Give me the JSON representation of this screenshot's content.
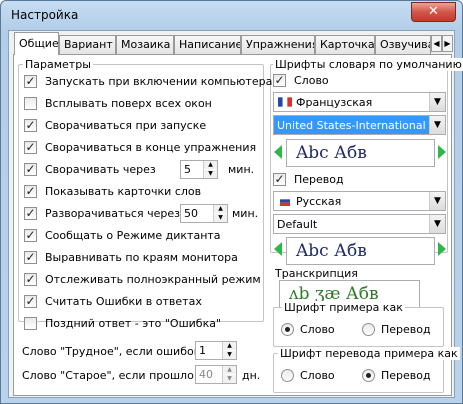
{
  "window": {
    "title": "Настройка",
    "close_glyph": "✕"
  },
  "tabs": [
    "Общие",
    "Вариант",
    "Мозаика",
    "Написание",
    "Упражнения",
    "Карточка",
    "Озвучива"
  ],
  "tab_scroll": {
    "left": "◀",
    "right": "▶"
  },
  "params": {
    "legend": "Параметры",
    "items": [
      {
        "label": "Запускать при включении компьютера",
        "checked": true
      },
      {
        "label": "Всплывать поверх всех окон",
        "checked": false
      },
      {
        "label": "Сворачиваться при запуске",
        "checked": true
      },
      {
        "label": "Сворачиваться в конце упражнения",
        "checked": true
      },
      {
        "label": "Сворачивать через",
        "checked": true
      },
      {
        "label": "Показывать карточки слов",
        "checked": true
      },
      {
        "label": "Разворачиваться через",
        "checked": true
      },
      {
        "label": "Сообщать о Режиме диктанта",
        "checked": true
      },
      {
        "label": "Выравнивать по краям монитора",
        "checked": true
      },
      {
        "label": "Отслеживать полноэкранный режим",
        "checked": true
      },
      {
        "label": "Считать Ошибки в ответах",
        "checked": true
      },
      {
        "label": "Поздний ответ - это \"Ошибка\"",
        "checked": false
      }
    ],
    "collapse_value": "5",
    "collapse_unit": "мин.",
    "expand_value": "50",
    "expand_unit": "мин.",
    "hard_label": "Слово \"Трудное\", если ошибок >",
    "hard_value": "1",
    "old_label": "Слово \"Старое\", если прошло >",
    "old_value": "40",
    "old_unit": "дн."
  },
  "fonts": {
    "legend": "Шрифты словаря по умолчанию",
    "word_label": "Слово",
    "word_checked": true,
    "word_language": "Французская",
    "word_layout": "United States-International ...",
    "word_sample": "Abc Абв",
    "translation_label": "Перевод",
    "translation_checked": true,
    "translation_language": "Русская",
    "translation_layout": "Default",
    "translation_sample": "Abc Абв",
    "transcription_legend": "Транскрипция",
    "transcription_sample": "ʌb ʒæ Абв",
    "example_font_legend": "Шрифт примера как",
    "example_font_options": [
      "Слово",
      "Перевод"
    ],
    "example_font_selected": 0,
    "example_translation_legend": "Шрифт перевода примера как",
    "example_translation_options": [
      "Слово",
      "Перевод"
    ],
    "example_translation_selected": 1
  },
  "colors": {
    "sample_text": "#1f2a66",
    "arrow_green": "#2fb64a",
    "selection_blue": "#3399ff",
    "transcription_text": "#2f7a2a"
  },
  "checkmark": "✓",
  "dropdown_glyph": "▼",
  "spin_up_glyph": "▲",
  "spin_down_glyph": "▼"
}
